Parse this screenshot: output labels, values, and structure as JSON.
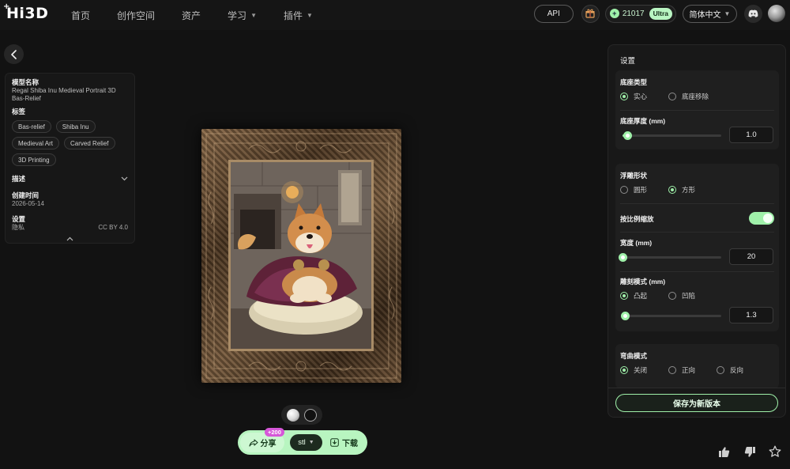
{
  "brand": {
    "logo": "Hi3D",
    "plus": "+"
  },
  "nav": {
    "home": "首页",
    "workspace": "创作空间",
    "assets": "资产",
    "learn": "学习",
    "plugins": "插件"
  },
  "topbar": {
    "api_label": "API",
    "credits": "21017",
    "plan_badge": "Ultra",
    "language": "简体中文"
  },
  "info": {
    "model_name_label": "模型名称",
    "model_name": "Regal Shiba Inu Medieval Portrait 3D Bas-Relief",
    "tags_label": "标签",
    "tags": [
      "Bas-relief",
      "Shiba Inu",
      "Medieval Art",
      "Carved Relief",
      "3D Printing"
    ],
    "description_label": "描述",
    "created_label": "创建时间",
    "created_value": "2026-05-14",
    "settings_label": "设置",
    "privacy_label": "隐私",
    "license": "CC BY 4.0"
  },
  "actions": {
    "share_label": "分享",
    "share_badge": "+200",
    "format": "stl",
    "download_label": "下载"
  },
  "settings": {
    "title": "设置",
    "base_type_label": "底座类型",
    "base_solid": "实心",
    "base_remove": "底座移除",
    "base_type_selected": "实心",
    "base_thickness_label": "底座厚度 (mm)",
    "base_thickness": "1.0",
    "base_thickness_fraction": 0.05,
    "relief_shape_label": "浮雕形状",
    "shape_round": "圆形",
    "shape_square": "方形",
    "relief_shape_selected": "方形",
    "proportional_label": "按比例缩放",
    "proportional_on": true,
    "width_label": "宽度 (mm)",
    "width": "20",
    "width_fraction": 0.0,
    "carve_mode_label": "雕刻模式 (mm)",
    "carve_raised": "凸起",
    "carve_sunken": "凹陷",
    "carve_mode_selected": "凸起",
    "carve_depth": "1.3",
    "carve_depth_fraction": 0.02,
    "bend_mode_label": "弯曲模式",
    "bend_off": "关闭",
    "bend_forward": "正向",
    "bend_reverse": "反向",
    "bend_mode_selected": "关闭",
    "save_label": "保存为新版本"
  },
  "colors": {
    "accent": "#9ff0a9",
    "background": "#121212",
    "panel": "#181818"
  },
  "icons": {
    "back": "chevron-left-icon",
    "gift": "gift-icon",
    "discord": "discord-icon",
    "share": "share-icon",
    "download": "download-icon",
    "thumbs_up": "thumbs-up-icon",
    "thumbs_down": "thumbs-down-icon",
    "star": "star-icon"
  }
}
